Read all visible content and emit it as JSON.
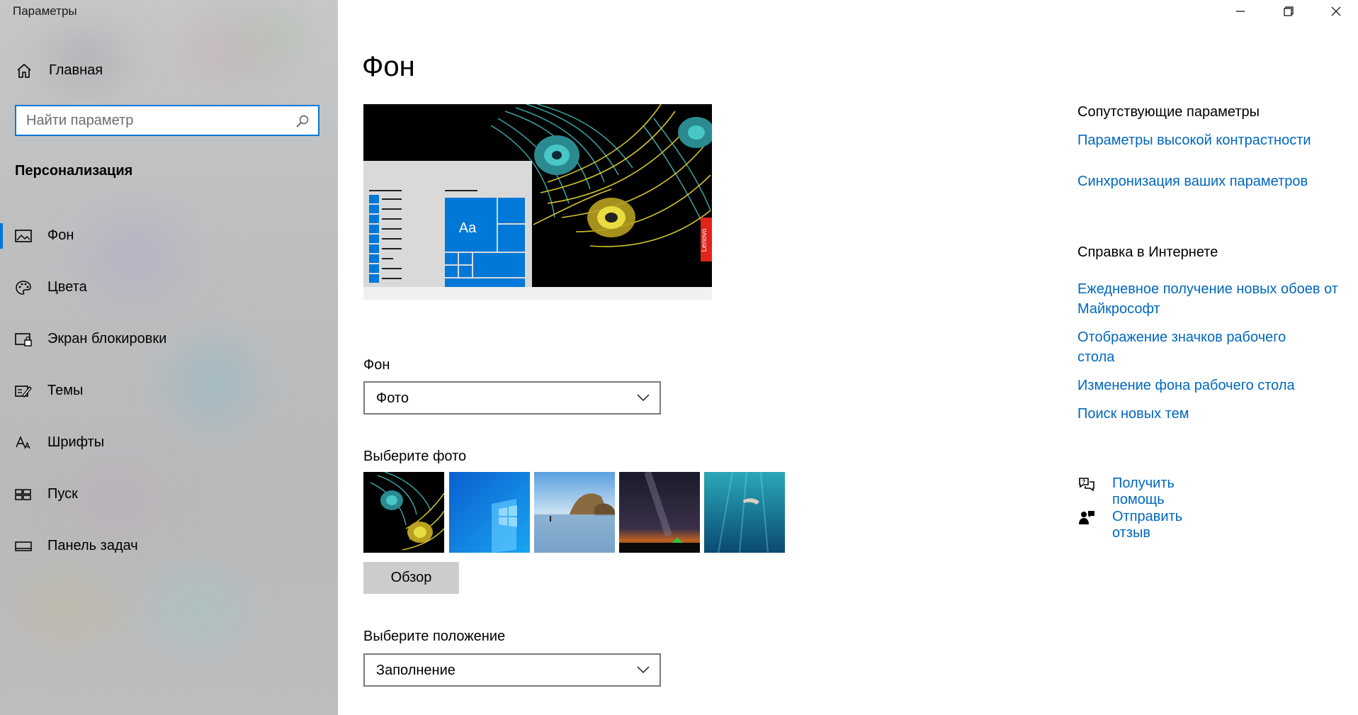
{
  "window": {
    "title": "Параметры",
    "controls": {
      "minimize_icon": "minimize-icon",
      "restore_icon": "restore-icon",
      "close_icon": "close-icon"
    }
  },
  "sidebar": {
    "home_label": "Главная",
    "home_icon": "home-icon",
    "search": {
      "placeholder": "Найти параметр",
      "value": "",
      "icon": "search-icon"
    },
    "section_title": "Персонализация",
    "items": [
      {
        "label": "Фон",
        "icon": "picture-icon",
        "active": true
      },
      {
        "label": "Цвета",
        "icon": "palette-icon",
        "active": false
      },
      {
        "label": "Экран блокировки",
        "icon": "lock-screen-icon",
        "active": false
      },
      {
        "label": "Темы",
        "icon": "themes-icon",
        "active": false
      },
      {
        "label": "Шрифты",
        "icon": "fonts-icon",
        "active": false
      },
      {
        "label": "Пуск",
        "icon": "start-icon",
        "active": false
      },
      {
        "label": "Панель задач",
        "icon": "taskbar-icon",
        "active": false
      }
    ]
  },
  "main": {
    "title": "Фон",
    "preview": {
      "tile_text": "Aa",
      "watermark_text": "Lenovo"
    },
    "background": {
      "label": "Фон",
      "value": "Фото"
    },
    "photos": {
      "label": "Выберите фото",
      "count": 5
    },
    "browse_label": "Обзор",
    "position": {
      "label": "Выберите положение",
      "value": "Заполнение"
    }
  },
  "related": {
    "heading": "Сопутствующие параметры",
    "links": [
      "Параметры высокой контрастности",
      "Синхронизация ваших параметров"
    ]
  },
  "web_help": {
    "heading": "Справка в Интернете",
    "links": [
      "Ежедневное получение новых обоев от Майкрософт",
      "Отображение значков рабочего стола",
      "Изменение фона рабочего стола",
      "Поиск новых тем"
    ]
  },
  "help": {
    "get_help": "Получить помощь",
    "get_help_icon": "help-chat-icon",
    "feedback": "Отправить отзыв",
    "feedback_icon": "feedback-icon"
  },
  "colors": {
    "accent": "#0078d7",
    "link": "#0067c0",
    "sidebar_bg": "#bfc0c2"
  }
}
